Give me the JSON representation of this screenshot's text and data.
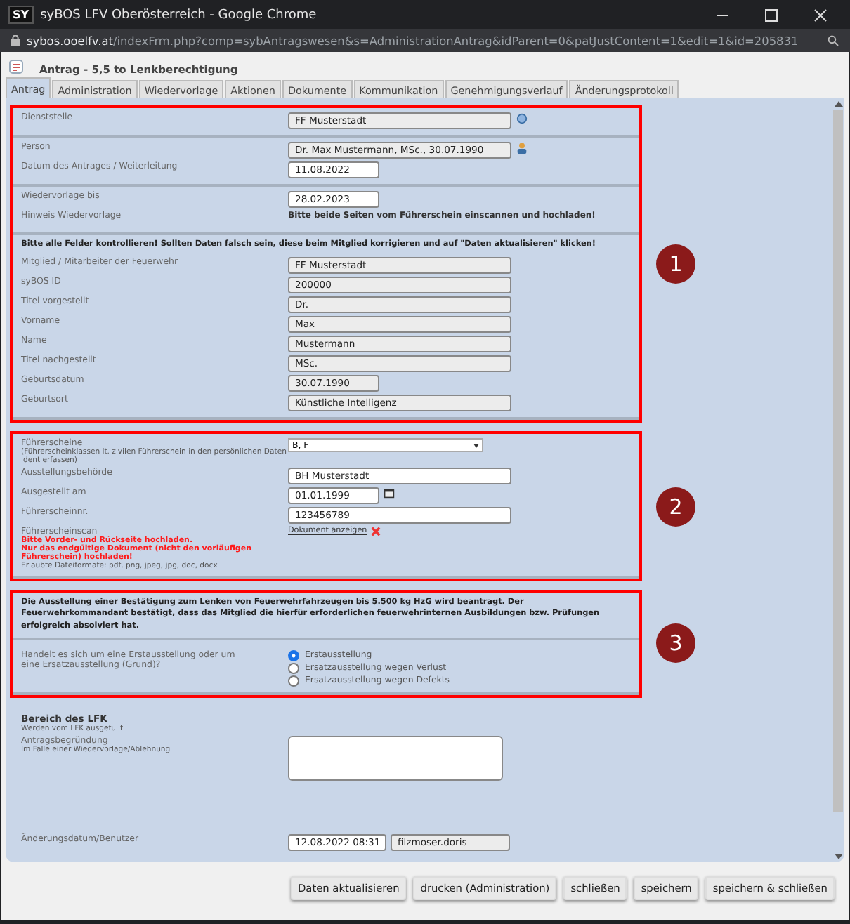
{
  "window": {
    "logo": "SY",
    "title": "syBOS LFV Oberösterreich - Google Chrome",
    "url_host": "sybos.ooelfv.at",
    "url_path": "/indexFrm.php?comp=sybAntragswesen&s=AdministrationAntrag&idParent=0&patJustContent=1&edit=1&id=205831"
  },
  "header": {
    "title": "Antrag - 5,5 to Lenkberechtigung"
  },
  "tabs": [
    {
      "label": "Antrag",
      "selected": true
    },
    {
      "label": "Administration",
      "selected": false
    },
    {
      "label": "Wiedervorlage",
      "selected": false
    },
    {
      "label": "Aktionen",
      "selected": false
    },
    {
      "label": "Dokumente",
      "selected": false
    },
    {
      "label": "Kommunikation",
      "selected": false
    },
    {
      "label": "Genehmigungsverlauf",
      "selected": false
    },
    {
      "label": "Änderungsprotokoll",
      "selected": false
    }
  ],
  "blocks": [
    {
      "marker": "1",
      "groups": [
        [
          {
            "kind": "unit",
            "label": "Dienststelle",
            "value": "FF Musterstadt",
            "readonly": true
          }
        ],
        [
          {
            "kind": "person",
            "label": "Person",
            "value": "Dr. Max Mustermann, MSc., 30.07.1990",
            "readonly": true
          },
          {
            "kind": "date",
            "label": "Datum des Antrages / Weiterleitung",
            "value": "11.08.2022",
            "readonly": false
          }
        ],
        [
          {
            "kind": "date",
            "label": "Wiedervorlage bis",
            "value": "28.02.2023",
            "readonly": false
          },
          {
            "kind": "info",
            "label": "Hinweis Wiedervorlage",
            "text": "Bitte beide Seiten vom Führerschein einscannen und hochladen!"
          }
        ],
        [
          {
            "kind": "heading",
            "text": "Bitte alle Felder kontrollieren! Sollten Daten falsch sein, diese beim Mitglied korrigieren und auf \"Daten aktualisieren\" klicken!"
          },
          {
            "kind": "input",
            "label": "Mitglied / Mitarbeiter der Feuerwehr",
            "value": "FF Musterstadt",
            "readonly": true
          },
          {
            "kind": "input",
            "label": "syBOS ID",
            "value": "200000",
            "readonly": true
          },
          {
            "kind": "input",
            "label": "Titel vorgestellt",
            "value": "Dr.",
            "readonly": true
          },
          {
            "kind": "input",
            "label": "Vorname",
            "value": "Max",
            "readonly": true
          },
          {
            "kind": "input",
            "label": "Name",
            "value": "Mustermann",
            "readonly": true
          },
          {
            "kind": "input",
            "label": "Titel nachgestellt",
            "value": "MSc.",
            "readonly": true
          },
          {
            "kind": "date",
            "label": "Geburtsdatum",
            "value": "30.07.1990",
            "readonly": true
          },
          {
            "kind": "input",
            "label": "Geburtsort",
            "value": "Künstliche Intelligenz",
            "readonly": true
          }
        ]
      ]
    },
    {
      "marker": "2",
      "groups": [
        [
          {
            "kind": "select",
            "label": "Führerscheine",
            "note": "(Führerscheinklassen lt. zivilen Führerschein in den persönlichen Daten ident erfassen)",
            "value": "B, F"
          },
          {
            "kind": "input",
            "label": "Ausstellungsbehörde",
            "value": "BH Musterstadt",
            "readonly": false
          },
          {
            "kind": "datepick",
            "label": "Ausgestellt am",
            "value": "01.01.1999",
            "readonly": false
          },
          {
            "kind": "input",
            "label": "Führerscheinnr.",
            "value": "123456789",
            "readonly": false
          },
          {
            "kind": "upload",
            "label": "Führerscheinscan",
            "warning": "Bitte Vorder- und Rückseite hochladen.\nNur das endgültige Dokument (nicht den vorläufigen Führerschein) hochladen!",
            "formats": "Erlaubte Dateiformate: pdf, png, jpeg, jpg, doc, docx",
            "link": "Dokument anzeigen"
          }
        ]
      ]
    },
    {
      "marker": "3",
      "groups": [
        [
          {
            "kind": "heading",
            "text": "Die Ausstellung einer Bestätigung zum Lenken von Feuerwehrfahrzeugen bis 5.500 kg HzG wird beantragt. Der Feuerwehrkommandant bestätigt, dass das Mitglied die hierfür erforderlichen feuerwehrinternen Ausbildungen bzw. Prüfungen erfolgreich absolviert hat."
          }
        ],
        [
          {
            "kind": "radio",
            "label": "Handelt es sich um eine Erstausstellung oder um eine Ersatzausstellung (Grund)?",
            "options": [
              {
                "label": "Erstausstellung",
                "selected": true
              },
              {
                "label": "Ersatzausstellung wegen Verlust",
                "selected": false
              },
              {
                "label": "Ersatzausstellung wegen Defekts",
                "selected": false
              }
            ]
          }
        ]
      ]
    },
    {
      "groups": [
        [
          {
            "kind": "title",
            "text": "Bereich des LFK",
            "note": "Werden vom LFK ausgefüllt"
          },
          {
            "kind": "textarea",
            "label": "Antragsbegründung",
            "note": "Im Falle einer Wiedervorlage/Ablehnung"
          },
          {
            "kind": "spacer"
          },
          {
            "kind": "pair",
            "label": "Änderungsdatum/Benutzer",
            "values": [
              "12.08.2022 08:31",
              "filzmoser.doris"
            ]
          }
        ]
      ]
    }
  ],
  "buttons": [
    "Daten aktualisieren",
    "drucken (Administration)",
    "schließen",
    "speichern",
    "speichern & schließen"
  ]
}
